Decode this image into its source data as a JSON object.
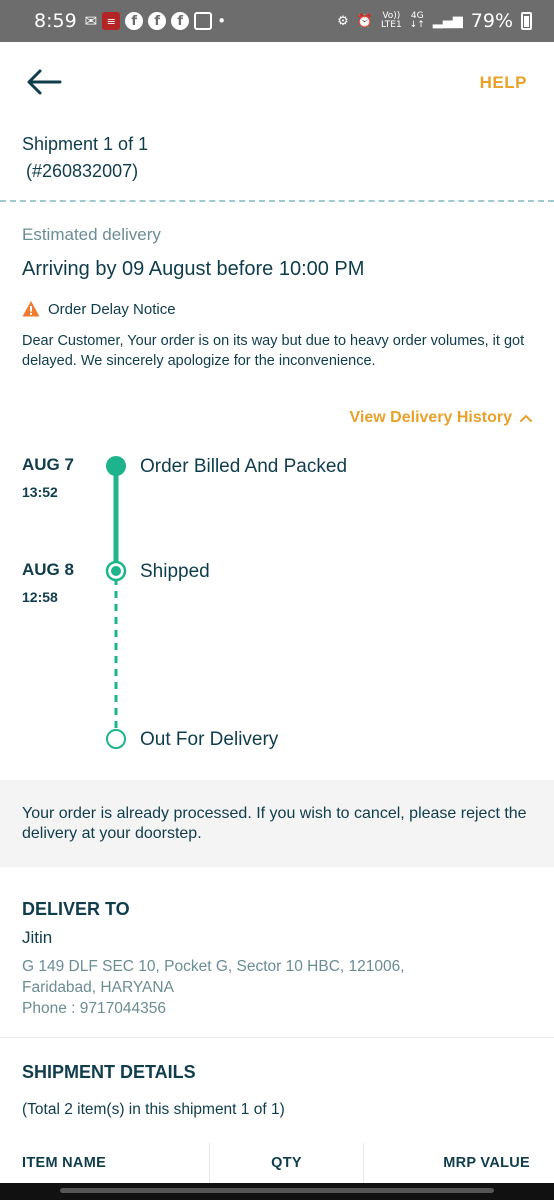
{
  "status_bar": {
    "time": "8:59",
    "network_label": "4G",
    "lte_label": "LTE1",
    "volte_label": "Vo))",
    "battery_percent": "79%"
  },
  "header": {
    "help_label": "HELP"
  },
  "shipment": {
    "title": "Shipment 1 of 1",
    "order_id": "(#260832007)"
  },
  "delivery": {
    "estimated_label": "Estimated delivery",
    "arriving_text": "Arriving by 09 August before 10:00 PM",
    "notice_title": "Order Delay Notice",
    "notice_body": "Dear Customer, Your order is on its way but due to heavy order volumes, it got delayed. We sincerely apologize for the inconvenience.",
    "history_link": "View Delivery History"
  },
  "timeline": [
    {
      "date": "AUG 7",
      "time": "13:52",
      "status": "Order Billed And Packed",
      "state": "done"
    },
    {
      "date": "AUG 8",
      "time": "12:58",
      "status": "Shipped",
      "state": "current"
    },
    {
      "date": "",
      "time": "",
      "status": "Out For Delivery",
      "state": "pending"
    }
  ],
  "processed_notice": "Your order is already processed. If you wish to cancel, please reject the delivery at your doorstep.",
  "deliver_to": {
    "title": "DELIVER TO",
    "name": "Jitin",
    "address_line1": "G 149 DLF SEC 10, Pocket G, Sector 10 HBC, 121006,",
    "address_line2": "Faridabad, HARYANA",
    "phone": "Phone : 9717044356"
  },
  "shipment_details": {
    "title": "SHIPMENT DETAILS",
    "subtitle": "(Total 2 item(s) in this shipment 1 of 1)",
    "columns": [
      "ITEM NAME",
      "QTY",
      "MRP VALUE"
    ]
  },
  "colors": {
    "primary_text": "#0f3d4c",
    "accent_orange": "#e8a22b",
    "timeline_green": "#1db38b",
    "muted_text": "#6b8d94",
    "warning": "#f07a2e"
  }
}
